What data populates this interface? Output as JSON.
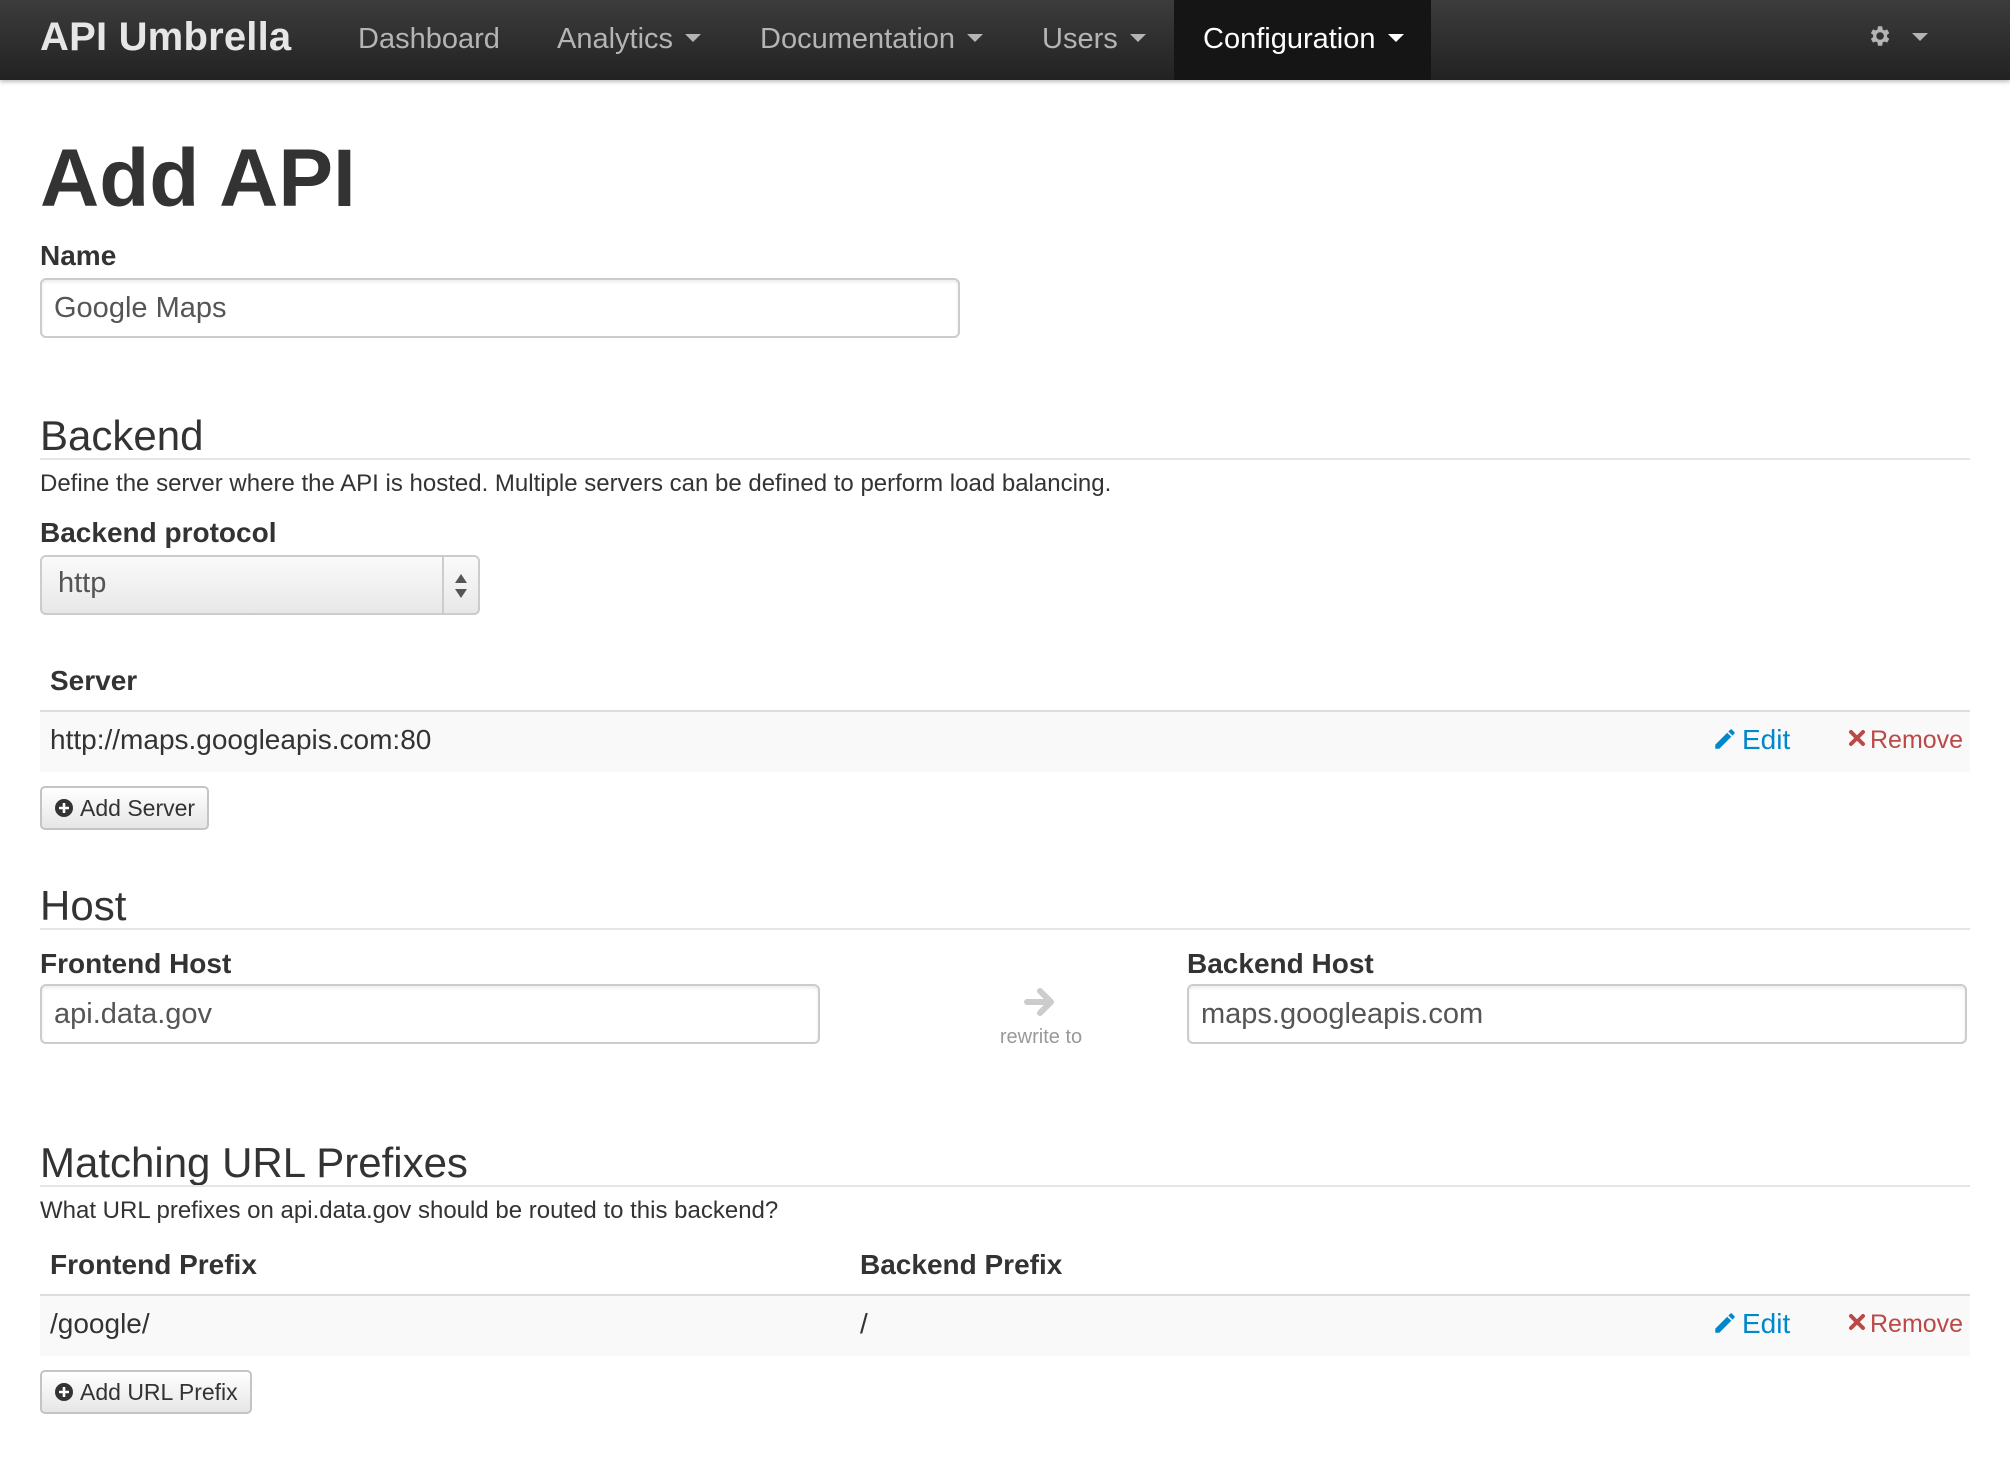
{
  "navbar": {
    "brand": "API Umbrella",
    "items": [
      {
        "label": "Dashboard"
      },
      {
        "label": "Analytics"
      },
      {
        "label": "Documentation"
      },
      {
        "label": "Users"
      },
      {
        "label": "Configuration"
      }
    ],
    "active": "Configuration",
    "settings_icon": "gear-icon"
  },
  "page": {
    "title": "Add API"
  },
  "name_field": {
    "label": "Name",
    "value": "Google Maps"
  },
  "backend": {
    "title": "Backend",
    "help": "Define the server where the API is hosted. Multiple servers can be defined to perform load balancing.",
    "protocol_label": "Backend protocol",
    "protocol_value": "http",
    "servers_header": "Server",
    "servers": [
      {
        "url": "http://maps.googleapis.com:80",
        "edit": "Edit",
        "remove": "Remove"
      }
    ],
    "add_server": "Add Server"
  },
  "host": {
    "title": "Host",
    "frontend_label": "Frontend Host",
    "frontend_value": "api.data.gov",
    "rewrite_text": "rewrite to",
    "backend_label": "Backend Host",
    "backend_value": "maps.googleapis.com"
  },
  "url_prefixes": {
    "title": "Matching URL Prefixes",
    "help": "What URL prefixes on api.data.gov should be routed to this backend?",
    "headers": [
      "Frontend Prefix",
      "Backend Prefix"
    ],
    "rows": [
      {
        "frontend": "/google/",
        "backend": "/",
        "edit": "Edit",
        "remove": "Remove"
      }
    ],
    "add_prefix": "Add URL Prefix"
  },
  "colors": {
    "navbar_bg": "#2c2c2c",
    "link": "#0088cc",
    "danger": "#b94a48",
    "text": "#333333"
  }
}
